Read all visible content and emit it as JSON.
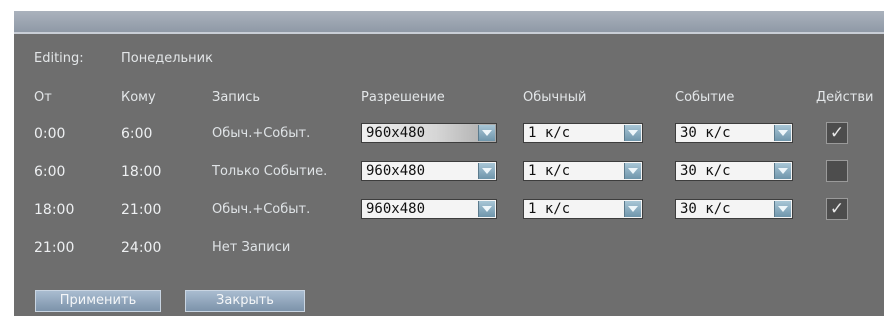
{
  "editing": {
    "label": "Editing:",
    "day": "Понедельник"
  },
  "columns": {
    "from": "От",
    "to": "Кому",
    "record": "Запись",
    "resolution": "Разрешение",
    "normal": "Обычный",
    "event": "Событие",
    "action": "Действи"
  },
  "rows": [
    {
      "from": "0:00",
      "to": "6:00",
      "record": "Обыч.+Событ.",
      "resolution": "960x480",
      "normal": "1 к/с",
      "event": "30 к/с",
      "action": "✓"
    },
    {
      "from": "6:00",
      "to": "18:00",
      "record": "Только Событие.",
      "resolution": "960x480",
      "normal": "1 к/с",
      "event": "30 к/с",
      "action": ""
    },
    {
      "from": "18:00",
      "to": "21:00",
      "record": "Обыч.+Событ.",
      "resolution": "960x480",
      "normal": "1 к/с",
      "event": "30 к/с",
      "action": "✓"
    },
    {
      "from": "21:00",
      "to": "24:00",
      "record": "Нет Записи"
    }
  ],
  "buttons": {
    "apply": "Применить",
    "close": "Закрыть"
  },
  "colors": {
    "panel": "#6e6e6e",
    "title_bar": "#9aa3ae",
    "button": "#8ea3b9",
    "dropdown_arrow": "#7fa3b8"
  }
}
